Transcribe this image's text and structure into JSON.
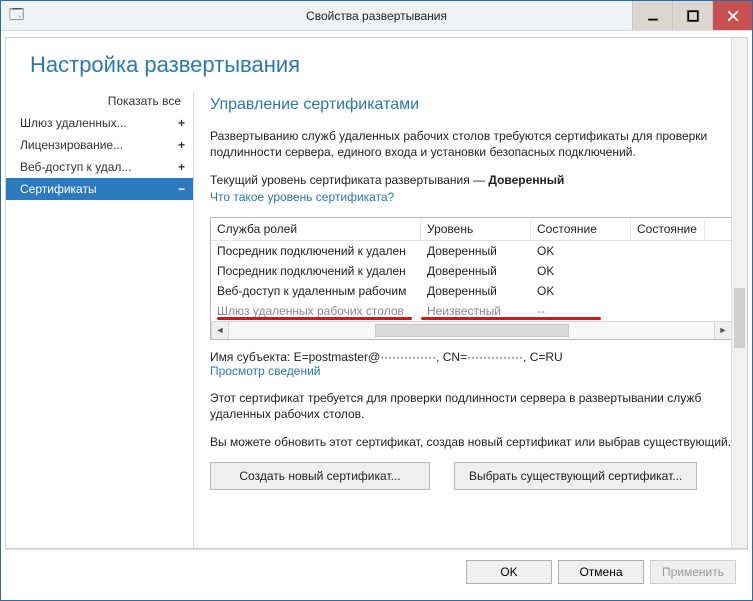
{
  "window": {
    "title": "Свойства развертывания"
  },
  "page_title": "Настройка развертывания",
  "sidebar": {
    "show_all": "Показать все",
    "items": [
      {
        "label": "Шлюз удаленных...",
        "expand": "+",
        "active": false
      },
      {
        "label": "Лицензирование...",
        "expand": "+",
        "active": false
      },
      {
        "label": "Веб-доступ к удал...",
        "expand": "+",
        "active": false
      },
      {
        "label": "Сертификаты",
        "expand": "−",
        "active": true
      }
    ]
  },
  "content": {
    "heading": "Управление сертификатами",
    "intro": "Развертыванию служб удаленных рабочих столов требуются сертификаты для проверки подлинности сервера, единого входа и установки безопасных подключений.",
    "level_line_prefix": "Текущий уровень сертификата развертывания — ",
    "level_value": "Доверенный",
    "level_help_link": "Что такое уровень сертификата?",
    "table": {
      "headers": [
        "Служба ролей",
        "Уровень",
        "Состояние",
        "Состояние"
      ],
      "rows": [
        {
          "svc": "Посредник подключений к удален",
          "lvl": "Доверенный",
          "st1": "OK",
          "st2": ""
        },
        {
          "svc": "Посредник подключений к удален",
          "lvl": "Доверенный",
          "st1": "OK",
          "st2": ""
        },
        {
          "svc": "Веб-доступ к удаленным рабочим",
          "lvl": "Доверенный",
          "st1": "OK",
          "st2": ""
        },
        {
          "svc": "Шлюз удаленных рабочих столов",
          "lvl": "Неизвестный",
          "st1": "--",
          "st2": "",
          "disabled": true
        }
      ]
    },
    "subject_label": "Имя субъекта: ",
    "subject_value": "E=postmaster@··············, CN=··············, C=RU",
    "subject_detail_link": "Просмотр сведений",
    "need_text": "Этот сертификат требуется для проверки подлинности сервера в развертывании служб удаленных рабочих столов.",
    "update_text": "Вы можете обновить этот сертификат, создав новый сертификат или выбрав существующий.",
    "btn_new": "Создать новый сертификат...",
    "btn_existing": "Выбрать существующий сертификат..."
  },
  "footer": {
    "ok": "OK",
    "cancel": "Отмена",
    "apply": "Применить"
  }
}
